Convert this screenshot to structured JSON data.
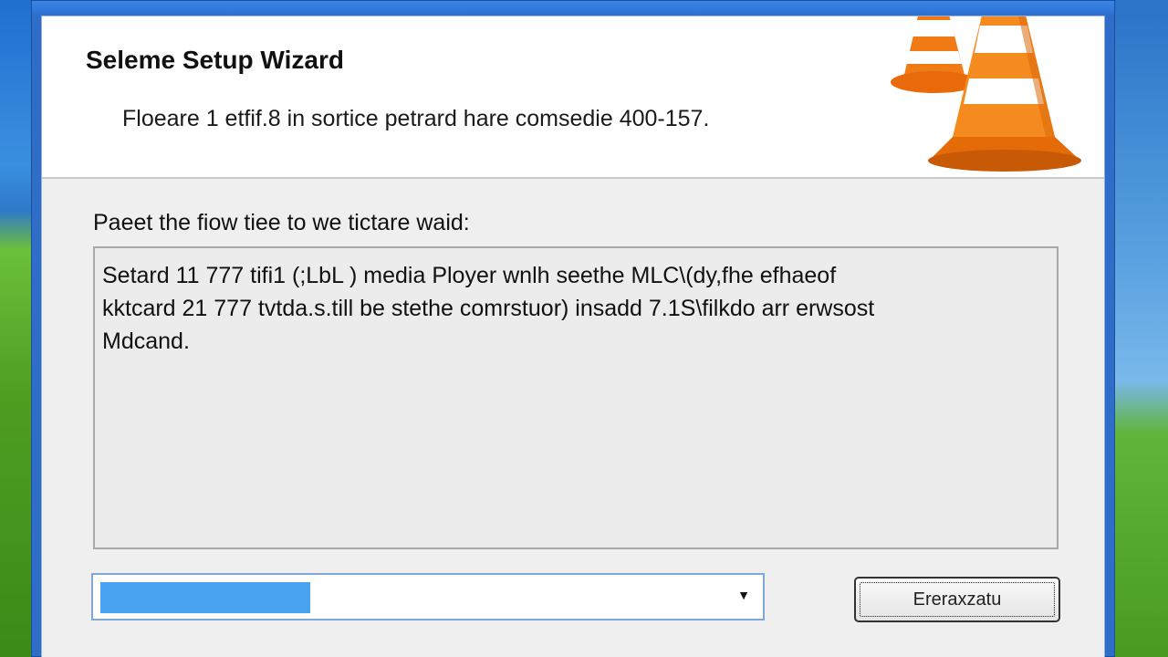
{
  "window": {
    "title": "Seleme Setup Wizard",
    "subtitle": "Floeare 1 etfif.8 in sortice petrard hare comsedie 400-157."
  },
  "body": {
    "instruction": "Paeet the fiow tiee to we tictare waid:",
    "message_lines": [
      "Setard 11 777 tifi1 (;LbL ) media Ployer wnlh seethe MLC\\(dy,fhe efhaeof",
      "kktcard 21 777 tvtda.s.till be stethe comrstuor) insadd 7.1S\\filkdo arr erwsost",
      "Mdcand."
    ]
  },
  "progress": {
    "value_percent": 32,
    "arrow": "▼"
  },
  "button": {
    "label": "Ereraxzatu"
  },
  "colors": {
    "progress_fill": "#4aa3f0",
    "cone_orange": "#f07a14",
    "frame_blue": "#2f6ec8"
  },
  "icons": {
    "logo": "traffic-cone-icon"
  }
}
